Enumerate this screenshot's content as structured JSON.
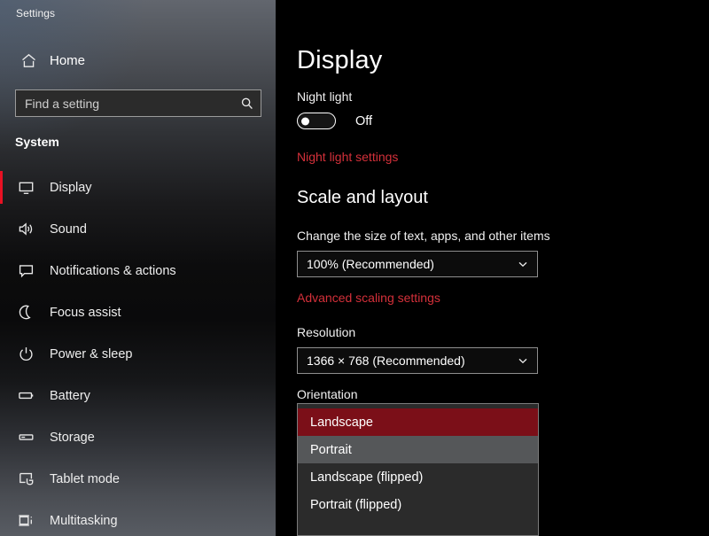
{
  "window": {
    "title": "Settings"
  },
  "sidebar": {
    "home": {
      "label": "Home",
      "icon": "home-icon"
    },
    "search": {
      "placeholder": "Find a setting",
      "icon": "search-icon"
    },
    "group_header": "System",
    "items": [
      {
        "label": "Display",
        "icon": "monitor-icon",
        "selected": true
      },
      {
        "label": "Sound",
        "icon": "speaker-icon",
        "selected": false
      },
      {
        "label": "Notifications & actions",
        "icon": "speech-bubble-icon",
        "selected": false
      },
      {
        "label": "Focus assist",
        "icon": "moon-icon",
        "selected": false
      },
      {
        "label": "Power & sleep",
        "icon": "power-icon",
        "selected": false
      },
      {
        "label": "Battery",
        "icon": "battery-icon",
        "selected": false
      },
      {
        "label": "Storage",
        "icon": "drive-icon",
        "selected": false
      },
      {
        "label": "Tablet mode",
        "icon": "tablet-hand-icon",
        "selected": false
      },
      {
        "label": "Multitasking",
        "icon": "multitasking-icon",
        "selected": false
      }
    ]
  },
  "main": {
    "page_title": "Display",
    "night_light": {
      "label": "Night light",
      "toggle_state": "Off",
      "settings_link": "Night light settings"
    },
    "scale_and_layout": {
      "heading": "Scale and layout",
      "scale_label": "Change the size of text, apps, and other items",
      "scale_value": "100% (Recommended)",
      "advanced_link": "Advanced scaling settings"
    },
    "resolution": {
      "label": "Resolution",
      "value": "1366 × 768 (Recommended)"
    },
    "orientation": {
      "label": "Orientation",
      "options": [
        {
          "label": "Landscape",
          "state": "selected"
        },
        {
          "label": "Portrait",
          "state": "hover"
        },
        {
          "label": "Landscape (flipped)",
          "state": "normal"
        },
        {
          "label": "Portrait (flipped)",
          "state": "normal"
        }
      ]
    }
  },
  "colors": {
    "accent_red": "#e81123",
    "link_red": "#d4303a",
    "selected_option_bg": "#7b0f18",
    "hover_option_bg": "#555759",
    "dropdown_bg": "#2b2b2b",
    "content_bg": "#000000"
  }
}
